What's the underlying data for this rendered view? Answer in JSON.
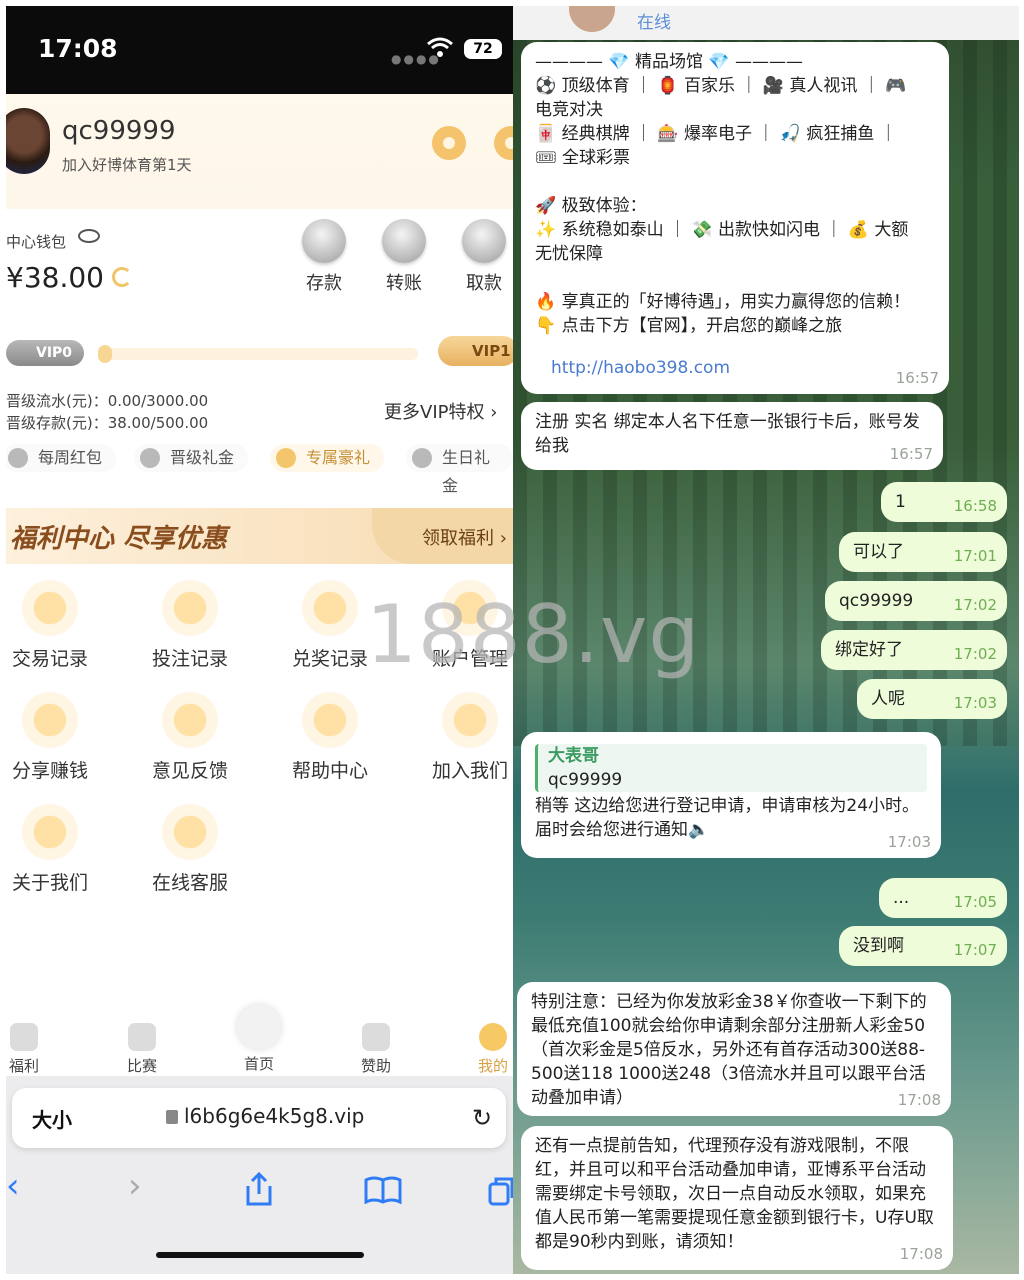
{
  "status": {
    "time": "17:08",
    "battery": "72"
  },
  "user": {
    "name": "qc99999",
    "subtitle": "加入好博体育第1天"
  },
  "wallet": {
    "label": "中心钱包",
    "balance": "¥38.00",
    "actions": [
      "存款",
      "转账",
      "取款"
    ]
  },
  "vip": {
    "current": "VIP0",
    "next": "VIP1",
    "line1": "晋级流水(元)：0.00/3000.00",
    "line2": "晋级存款(元)：38.00/500.00",
    "more": "更多VIP特权 ›",
    "gifts": [
      "每周红包",
      "晋级礼金",
      "专属豪礼",
      "生日礼金"
    ]
  },
  "fuli": {
    "title": "福利中心 尽享优惠",
    "button": "领取福利 ›"
  },
  "grid": [
    "交易记录",
    "投注记录",
    "兑奖记录",
    "账户管理",
    "分享赚钱",
    "意见反馈",
    "帮助中心",
    "加入我们",
    "关于我们",
    "在线客服"
  ],
  "tabs": [
    "福利",
    "比赛",
    "首页",
    "赞助",
    "我的"
  ],
  "browser": {
    "aa": "大小",
    "url": "l6b6g6e4k5g8.vip"
  },
  "chat": {
    "header_status": "在线",
    "promo_lines": [
      "———— 💎 精品场馆 💎 ————",
      "⚽ 顶级体育 ｜ 🏮 百家乐 ｜ 🎥 真人视讯 ｜ 🎮",
      "电竞对决",
      "🀄 经典棋牌 ｜ 🎰 爆率电子 ｜ 🎣 疯狂捕鱼 ｜",
      "🎟 全球彩票",
      "",
      "🚀 极致体验：",
      "✨ 系统稳如泰山 ｜ 💸 出款快如闪电 ｜ 💰 大额",
      "无忧保障",
      "",
      "🔥 享真正的「好博待遇」，用实力赢得您的信赖！",
      "👇 点击下方【官网】，开启您的巅峰之旅"
    ],
    "promo_link": "http://haobo398.com",
    "promo_time": "16:57",
    "register_text": "注册 实名 绑定本人名下任意一张银行卡后，账号发给我",
    "register_time": "16:57",
    "out": [
      {
        "text": "1",
        "time": "16:58"
      },
      {
        "text": "可以了",
        "time": "17:01"
      },
      {
        "text": "qc99999",
        "time": "17:02"
      },
      {
        "text": "绑定好了",
        "time": "17:02"
      },
      {
        "text": "人呢",
        "time": "17:03"
      }
    ],
    "reply_name": "大表哥",
    "reply_quote": "qc99999",
    "reply_text": "稍等 这边给您进行登记申请，申请审核为24小时。届时会给您进行通知🔈",
    "reply_time": "17:03",
    "out2": [
      {
        "text": "...",
        "time": "17:05"
      },
      {
        "text": "没到啊",
        "time": "17:07"
      }
    ],
    "notice1": "特别注意：已经为你发放彩金38￥你查收一下剩下的最低充值100就会给你申请剩余部分注册新人彩金50（首次彩金是5倍反水，另外还有首存活动300送88-500送118 1000送248（3倍流水并且可以跟平台活动叠加申请）",
    "notice1_time": "17:08",
    "notice2": "还有一点提前告知，代理预存没有游戏限制，不限红，并且可以和平台活动叠加申请，亚博系平台活动需要绑定卡号领取，次日一点自动反水领取，如果充值人民币第一笔需要提现任意金额到银行卡，U存U取都是90秒内到账，请须知！",
    "notice2_time": "17:08"
  },
  "watermark": "1888.vg"
}
